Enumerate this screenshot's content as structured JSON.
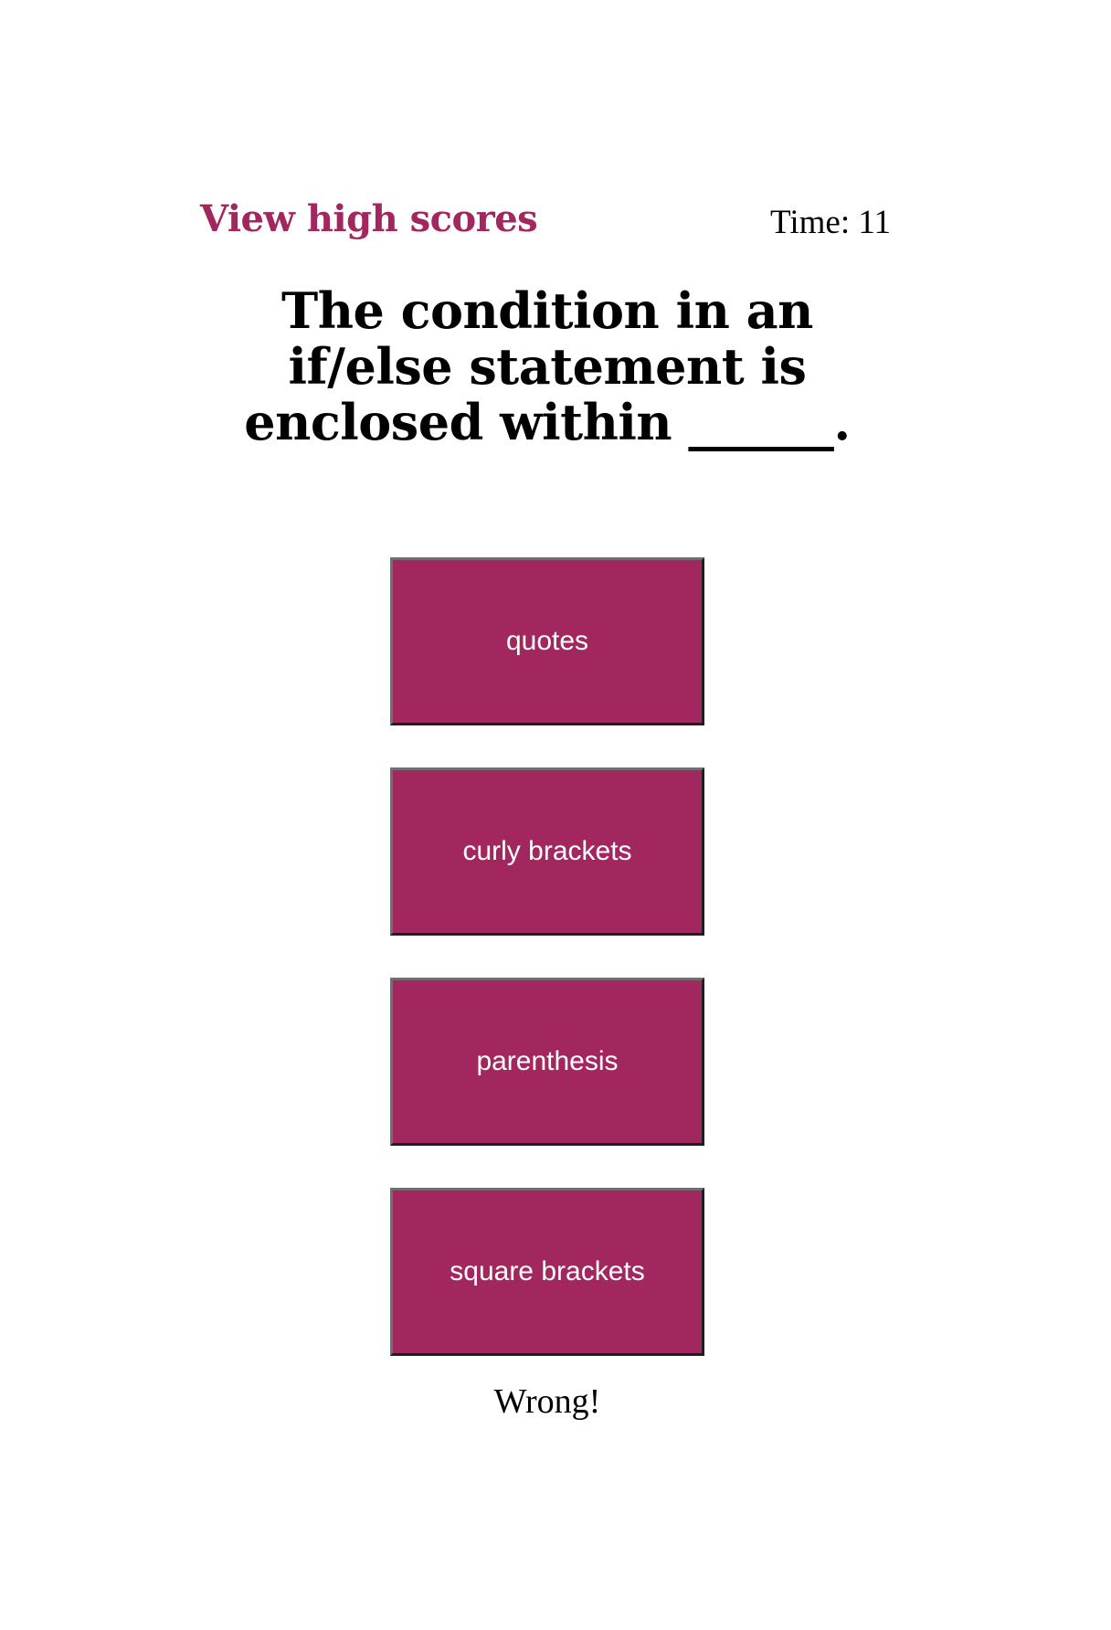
{
  "header": {
    "high_scores_label": "View high scores",
    "timer_text": "Time: 11"
  },
  "question": {
    "text": "The condition in an if/else statement is enclosed within ______."
  },
  "choices": [
    {
      "label": "quotes"
    },
    {
      "label": "curly brackets"
    },
    {
      "label": "parenthesis"
    },
    {
      "label": "square brackets"
    }
  ],
  "feedback": {
    "text": "Wrong!"
  },
  "colors": {
    "accent": "#a2275f",
    "button_text": "#ffffff",
    "text": "#000000",
    "background": "#ffffff"
  }
}
